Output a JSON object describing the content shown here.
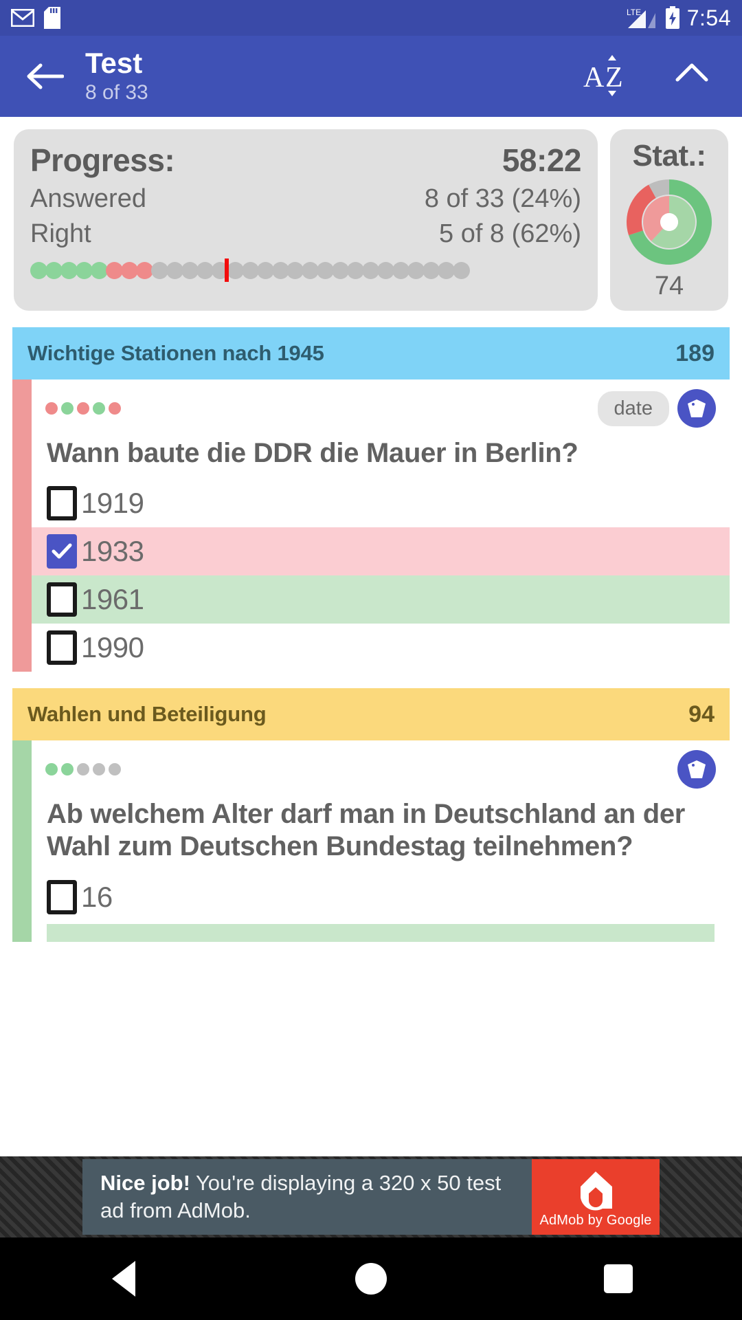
{
  "status_bar": {
    "icons": [
      "gmail-icon",
      "sd-card-icon",
      "lte-signal-icon",
      "battery-charging-icon"
    ],
    "network": "LTE",
    "clock": "7:54"
  },
  "app_bar": {
    "back_label": "back-arrow",
    "title": "Test",
    "subtitle": "8 of 33",
    "sort_label": "AZ",
    "collapse_label": "collapse"
  },
  "progress_card": {
    "title": "Progress:",
    "timer": "58:22",
    "rows": [
      {
        "label": "Answered",
        "value": "8 of 33 (24%)"
      },
      {
        "label": "Right",
        "value": "5 of 8 (62%)"
      }
    ],
    "dots": [
      "green",
      "green",
      "green",
      "green",
      "green",
      "red",
      "red",
      "red",
      "gray",
      "gray",
      "gray",
      "gray",
      "gray",
      "gray",
      "gray",
      "gray",
      "gray",
      "gray",
      "gray",
      "gray",
      "gray",
      "gray",
      "gray",
      "gray",
      "gray",
      "gray",
      "gray",
      "gray",
      "gray"
    ],
    "cursor_index": 13
  },
  "stat_card": {
    "title": "Stat.:",
    "score": "74",
    "colors": {
      "outer_green": "#6cc47f",
      "outer_red": "#e8625f",
      "outer_gray": "#bdbdbd",
      "inner_green": "#a5d6a7",
      "inner_red": "#ef9a9a"
    }
  },
  "chart_data": {
    "type": "pie",
    "title": "Stat.:",
    "legend": "none",
    "series": [
      {
        "name": "outer ring",
        "labels": [
          "right",
          "wrong",
          "unanswered"
        ],
        "values": [
          70,
          22,
          8
        ],
        "colors": [
          "#6cc47f",
          "#e8625f",
          "#bdbdbd"
        ]
      },
      {
        "name": "inner ring",
        "labels": [
          "right",
          "wrong"
        ],
        "values": [
          62,
          38
        ],
        "colors": [
          "#a5d6a7",
          "#ef9a9a"
        ]
      }
    ],
    "center_label": "74"
  },
  "questions": [
    {
      "category": "Wichtige Stationen nach 1945",
      "category_count": "189",
      "category_color": "#7fd3f7",
      "stripe": "red",
      "difficulty_dots": [
        "red",
        "green",
        "red",
        "green",
        "red"
      ],
      "tag_chip": "date",
      "tag_icon": "tag-icon",
      "text": "Wann baute die DDR die Mauer in Berlin?",
      "options": [
        {
          "label": "1919",
          "checked": false,
          "state": "neutral"
        },
        {
          "label": "1933",
          "checked": true,
          "state": "wrong"
        },
        {
          "label": "1961",
          "checked": false,
          "state": "correct"
        },
        {
          "label": "1990",
          "checked": false,
          "state": "neutral"
        }
      ]
    },
    {
      "category": "Wahlen und Beteiligung",
      "category_count": "94",
      "category_color": "#fbd97c",
      "stripe": "green",
      "difficulty_dots": [
        "green",
        "green",
        "gray",
        "gray",
        "gray"
      ],
      "tag_chip": "",
      "tag_icon": "tag-icon",
      "text": "Ab welchem Alter darf man in Deutschland an der Wahl zum Deutschen Bundestag teilnehmen?",
      "options": [
        {
          "label": "16",
          "checked": false,
          "state": "neutral"
        }
      ]
    }
  ],
  "ad": {
    "headline": "Nice job!",
    "body": " You're displaying a 320 x 50 test ad from AdMob.",
    "logo_caption": "AdMob by Google",
    "logo_color": "#ea3f2c"
  },
  "nav_bar": {
    "back": "back-triangle-icon",
    "home": "home-circle-icon",
    "recents": "recents-square-icon"
  }
}
